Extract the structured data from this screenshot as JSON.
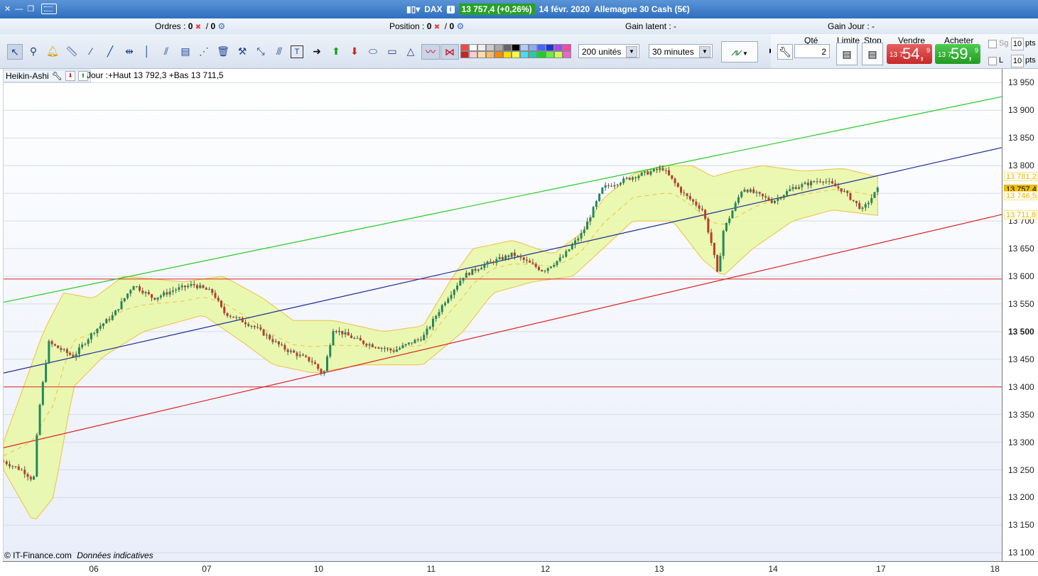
{
  "titlebar": {
    "symbol": "DAX",
    "price_change": "13 757,4 (+0,26%)",
    "date": "14 févr. 2020",
    "instrument": "Allemagne 30 Cash (5€)"
  },
  "status": {
    "ordres_label": "Ordres :",
    "ordres_value": "0",
    "ordres_value2": "0",
    "position_label": "Position :",
    "position_value": "0",
    "position_value2": "0",
    "gain_latent": "Gain latent : -",
    "gain_jour": "Gain Jour : -"
  },
  "toolbar": {
    "units": "200 unités",
    "interval": "30 minutes"
  },
  "order_panel": {
    "qte_label": "Qté",
    "qte_value": "2",
    "limite_label": "Limite",
    "stop_label": "Stop",
    "vendre_label": "Vendre",
    "acheter_label": "Acheter",
    "sell_small": "13 7",
    "sell_big": "54,",
    "sell_sup": "9",
    "buy_small": "13 7",
    "buy_big": "59,",
    "buy_sup": "9",
    "sg_label": "Sg",
    "l_label": "L",
    "pts_value_1": "10",
    "pts_value_2": "10",
    "pts_label": "pts"
  },
  "indicator": {
    "name": "Heikin-Ashi",
    "info": "Jour :+Haut 13 792,3 +Bas 13 711,5"
  },
  "chart_data": {
    "type": "candlestick",
    "series": [
      {
        "name": "Heikin-Ashi"
      }
    ],
    "x_ticks": [
      "06",
      "07",
      "10",
      "11",
      "12",
      "13",
      "14",
      "17",
      "18"
    ],
    "y_ticks": [
      "13 950",
      "13 900",
      "13 850",
      "13 800",
      "13 750",
      "13 700",
      "13 650",
      "13 600",
      "13 550",
      "13 500",
      "13 450",
      "13 400",
      "13 350",
      "13 300",
      "13 250",
      "13 200",
      "13 150",
      "13 100"
    ],
    "ylim": [
      13085,
      13975
    ],
    "last_price": "13 757,4",
    "price_tags": [
      "13 781,2",
      "13 746,5",
      "13 711,8"
    ],
    "grid": true,
    "horizontal_lines": [
      13595,
      13400
    ],
    "trend_lines": [
      {
        "color": "#22cc22",
        "from": [
          0,
          13553
        ],
        "to": [
          1,
          13925
        ]
      },
      {
        "color": "#1a2a99",
        "from": [
          0,
          13425
        ],
        "to": [
          1,
          13833
        ]
      },
      {
        "color": "#dd2222",
        "from": [
          0,
          13290
        ],
        "to": [
          1,
          13712
        ]
      }
    ],
    "price_path": [
      [
        0.0,
        13265
      ],
      [
        0.02,
        13248
      ],
      [
        0.03,
        13230
      ],
      [
        0.035,
        13350
      ],
      [
        0.045,
        13480
      ],
      [
        0.07,
        13455
      ],
      [
        0.09,
        13500
      ],
      [
        0.11,
        13530
      ],
      [
        0.13,
        13585
      ],
      [
        0.15,
        13560
      ],
      [
        0.17,
        13575
      ],
      [
        0.19,
        13585
      ],
      [
        0.21,
        13570
      ],
      [
        0.22,
        13535
      ],
      [
        0.25,
        13510
      ],
      [
        0.28,
        13470
      ],
      [
        0.31,
        13445
      ],
      [
        0.32,
        13420
      ],
      [
        0.33,
        13505
      ],
      [
        0.36,
        13480
      ],
      [
        0.39,
        13465
      ],
      [
        0.42,
        13490
      ],
      [
        0.44,
        13550
      ],
      [
        0.46,
        13600
      ],
      [
        0.48,
        13620
      ],
      [
        0.51,
        13640
      ],
      [
        0.54,
        13610
      ],
      [
        0.56,
        13635
      ],
      [
        0.58,
        13680
      ],
      [
        0.6,
        13760
      ],
      [
        0.63,
        13780
      ],
      [
        0.66,
        13795
      ],
      [
        0.68,
        13750
      ],
      [
        0.7,
        13720
      ],
      [
        0.71,
        13650
      ],
      [
        0.715,
        13600
      ],
      [
        0.72,
        13680
      ],
      [
        0.74,
        13760
      ],
      [
        0.77,
        13735
      ],
      [
        0.79,
        13760
      ],
      [
        0.82,
        13775
      ],
      [
        0.84,
        13755
      ],
      [
        0.86,
        13720
      ],
      [
        0.875,
        13757
      ]
    ],
    "bollinger_upper": [
      [
        0.0,
        13300
      ],
      [
        0.04,
        13500
      ],
      [
        0.06,
        13570
      ],
      [
        0.09,
        13560
      ],
      [
        0.12,
        13600
      ],
      [
        0.18,
        13590
      ],
      [
        0.22,
        13600
      ],
      [
        0.26,
        13560
      ],
      [
        0.29,
        13520
      ],
      [
        0.33,
        13520
      ],
      [
        0.38,
        13500
      ],
      [
        0.42,
        13510
      ],
      [
        0.45,
        13600
      ],
      [
        0.47,
        13650
      ],
      [
        0.51,
        13665
      ],
      [
        0.55,
        13640
      ],
      [
        0.58,
        13680
      ],
      [
        0.6,
        13740
      ],
      [
        0.63,
        13785
      ],
      [
        0.66,
        13800
      ],
      [
        0.69,
        13800
      ],
      [
        0.71,
        13780
      ],
      [
        0.73,
        13790
      ],
      [
        0.76,
        13800
      ],
      [
        0.8,
        13790
      ],
      [
        0.84,
        13795
      ],
      [
        0.875,
        13780
      ]
    ],
    "bollinger_lower": [
      [
        0.0,
        13250
      ],
      [
        0.03,
        13155
      ],
      [
        0.05,
        13200
      ],
      [
        0.07,
        13400
      ],
      [
        0.1,
        13455
      ],
      [
        0.14,
        13500
      ],
      [
        0.2,
        13530
      ],
      [
        0.24,
        13480
      ],
      [
        0.27,
        13440
      ],
      [
        0.31,
        13425
      ],
      [
        0.36,
        13440
      ],
      [
        0.42,
        13440
      ],
      [
        0.46,
        13500
      ],
      [
        0.49,
        13570
      ],
      [
        0.53,
        13590
      ],
      [
        0.57,
        13600
      ],
      [
        0.6,
        13650
      ],
      [
        0.63,
        13700
      ],
      [
        0.67,
        13700
      ],
      [
        0.7,
        13630
      ],
      [
        0.72,
        13600
      ],
      [
        0.75,
        13650
      ],
      [
        0.79,
        13700
      ],
      [
        0.83,
        13720
      ],
      [
        0.875,
        13710
      ]
    ]
  },
  "footer": {
    "copyright": "© IT-Finance.com",
    "disclaimer": "Données indicatives"
  },
  "colors": {
    "up": "#1f8a5a",
    "down": "#c0392b",
    "band_fill": "#e8f7a8",
    "band_line": "#f0c040"
  }
}
